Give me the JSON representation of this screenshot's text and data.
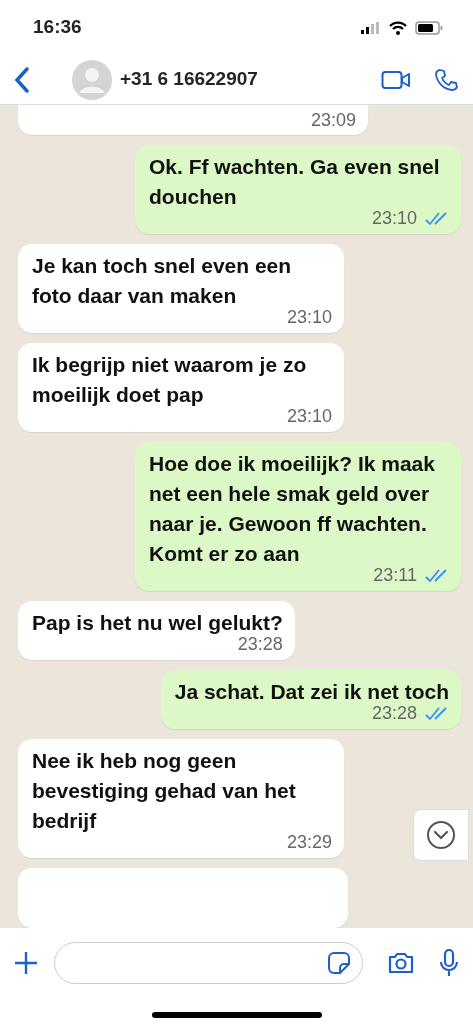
{
  "status_bar": {
    "time": "16:36"
  },
  "header": {
    "contact": "+31 6 16622907"
  },
  "messages": [
    {
      "outgoing": false,
      "time": "23:09"
    },
    {
      "outgoing": true,
      "text": "Ok. Ff wachten. Ga even snel douchen",
      "time": "23:10",
      "read": true
    },
    {
      "outgoing": false,
      "text": "Je kan toch snel even een foto daar van maken",
      "time": "23:10"
    },
    {
      "outgoing": false,
      "text": "Ik begrijp niet waarom je zo moeilijk doet pap",
      "time": "23:10"
    },
    {
      "outgoing": true,
      "text": "Hoe doe ik moeilijk? Ik maak net een hele smak geld over naar je. Gewoon ff wachten. Komt er zo aan",
      "time": "23:11",
      "read": true
    },
    {
      "outgoing": false,
      "text": "Pap is het nu wel gelukt?",
      "time": "23:28"
    },
    {
      "outgoing": true,
      "text": "Ja schat. Dat zei ik net toch",
      "time": "23:28",
      "read": true
    },
    {
      "outgoing": false,
      "text": "Nee ik heb nog geen bevestiging gehad van het bedrijf",
      "time": "23:29"
    },
    {
      "outgoing": false
    }
  ]
}
